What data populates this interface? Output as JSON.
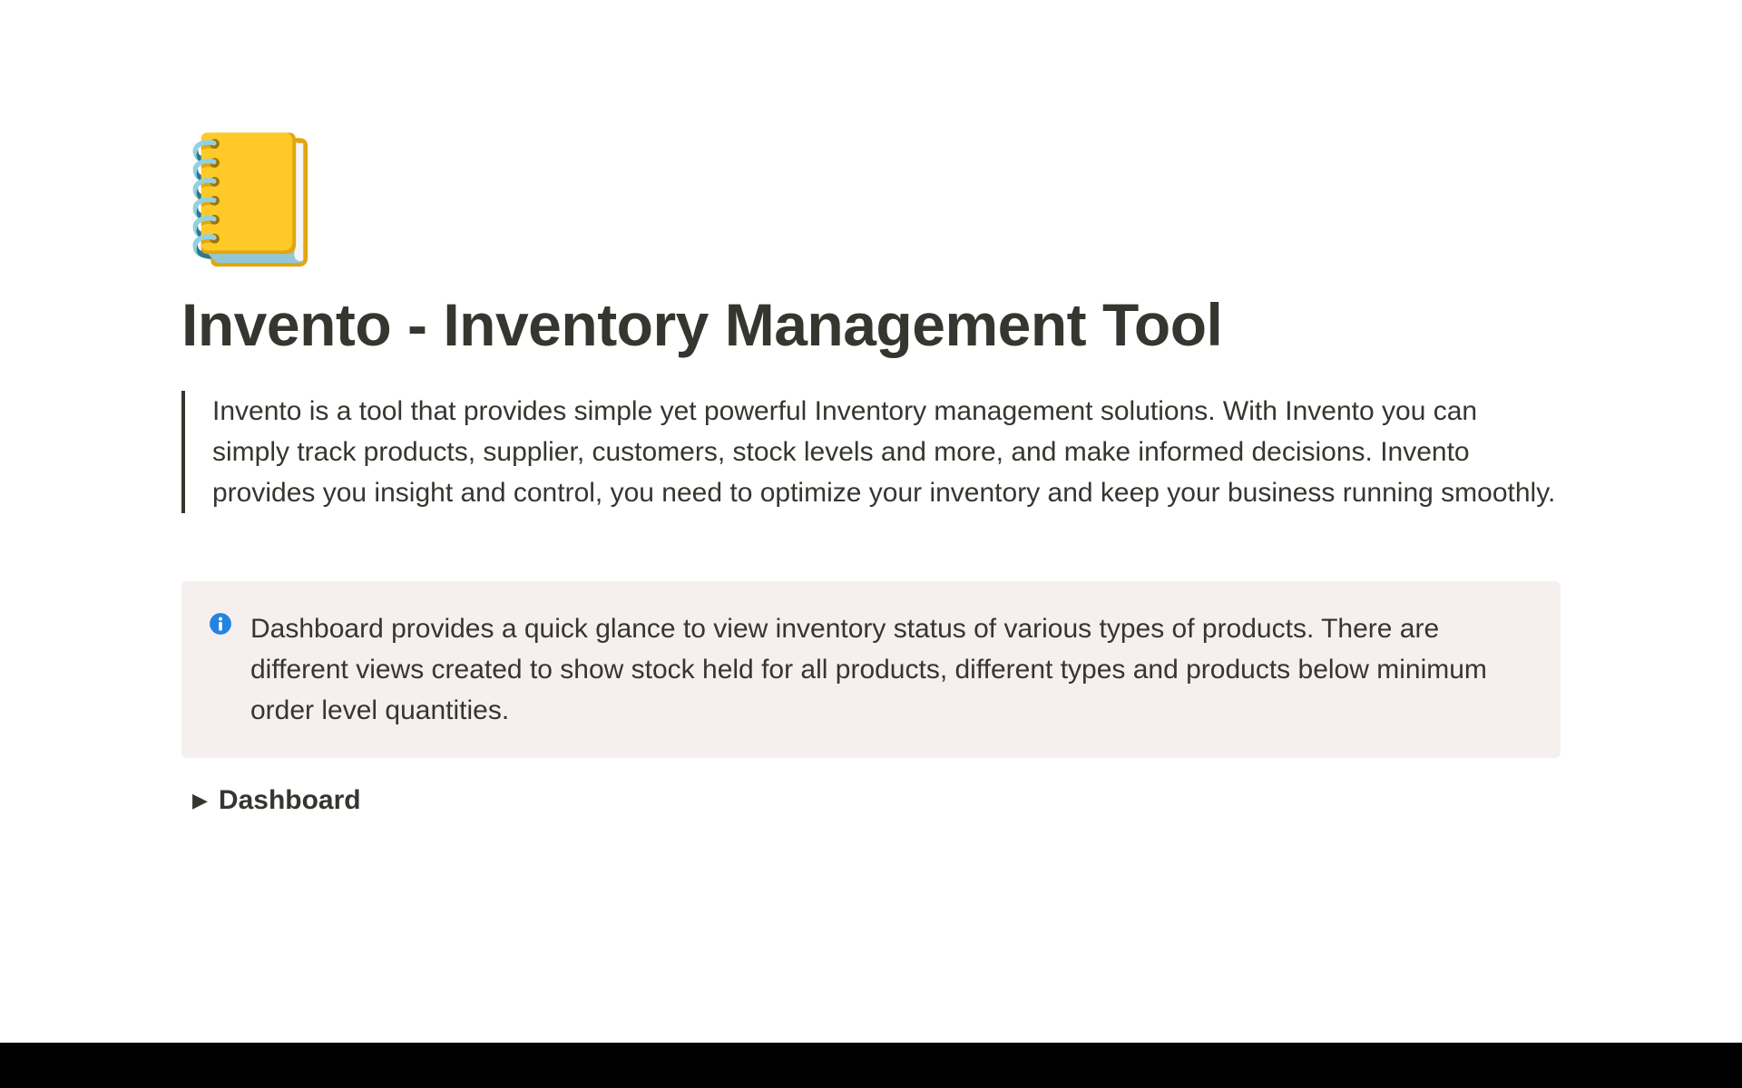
{
  "page": {
    "icon": "📒",
    "title": "Invento - Inventory Management Tool",
    "quote": "Invento is a tool that provides simple yet powerful Inventory management solutions. With Invento you can simply track products, supplier, customers, stock levels and more, and make informed decisions. Invento provides you insight and control, you need to optimize your inventory and keep your business running smoothly."
  },
  "callout": {
    "text": "Dashboard provides a quick glance to view inventory status of various types of products. There are different views created to show stock held for all products, different types and products below minimum order level quantities."
  },
  "toggle": {
    "label": "Dashboard"
  }
}
